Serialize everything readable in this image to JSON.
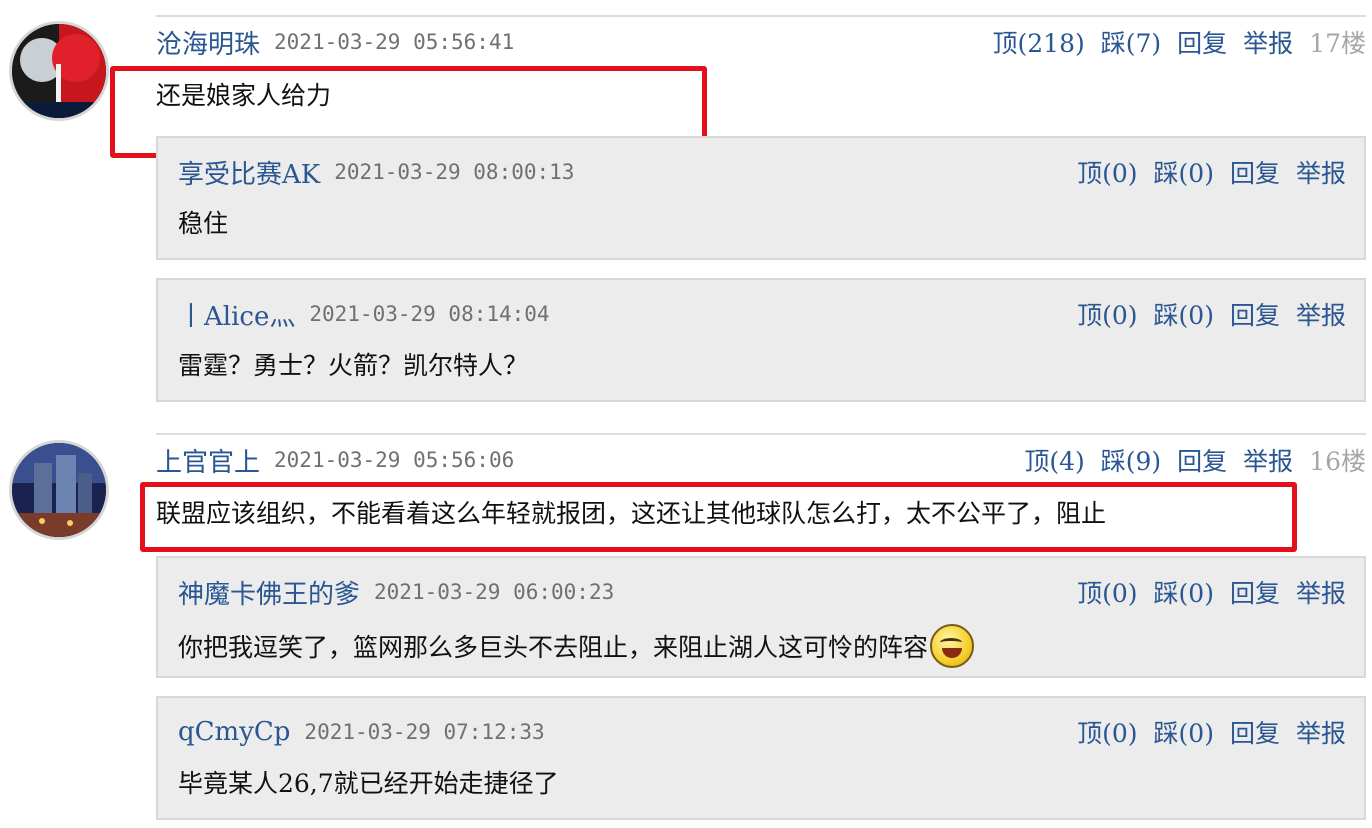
{
  "comments": [
    {
      "user": "沧海明珠",
      "time": "2021-03-29 05:56:41",
      "up": "顶(218)",
      "down": "踩(7)",
      "reply": "回复",
      "report": "举报",
      "floor": "17楼",
      "text": "还是娘家人给力",
      "replies": [
        {
          "user": "享受比赛AK",
          "time": "2021-03-29 08:00:13",
          "up": "顶(0)",
          "down": "踩(0)",
          "reply": "回复",
          "report": "举报",
          "text": "稳住"
        },
        {
          "user": "丨Alice灬",
          "time": "2021-03-29 08:14:04",
          "up": "顶(0)",
          "down": "踩(0)",
          "reply": "回复",
          "report": "举报",
          "text": "雷霆？勇士？火箭？凯尔特人？"
        }
      ]
    },
    {
      "user": "上官官上",
      "time": "2021-03-29 05:56:06",
      "up": "顶(4)",
      "down": "踩(9)",
      "reply": "回复",
      "report": "举报",
      "floor": "16楼",
      "text": "联盟应该组织，不能看着这么年轻就报团，这还让其他球队怎么打，太不公平了，阻止",
      "replies": [
        {
          "user": "神魔卡佛王的爹",
          "time": "2021-03-29 06:00:23",
          "up": "顶(0)",
          "down": "踩(0)",
          "reply": "回复",
          "report": "举报",
          "text": "你把我逗笑了，篮网那么多巨头不去阻止，来阻止湖人这可怜的阵容",
          "emoji": "laughing-emoji"
        },
        {
          "user": "qCmyCp",
          "time": "2021-03-29 07:12:33",
          "up": "顶(0)",
          "down": "踩(0)",
          "reply": "回复",
          "report": "举报",
          "text": "毕竟某人26,7就已经开始走捷径了"
        }
      ]
    }
  ],
  "colors": {
    "link": "#2a5692",
    "highlight": "#e3101c",
    "reply_bg": "#ececec",
    "muted": "#a6a6a6"
  }
}
